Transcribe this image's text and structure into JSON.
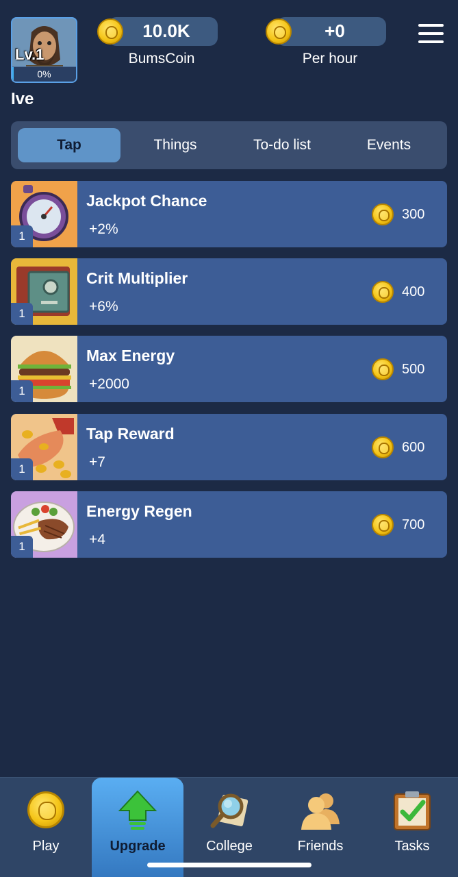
{
  "player": {
    "level": "Lv.1",
    "progress_text": "0%",
    "progress_fraction": 0.02,
    "username": "Ive"
  },
  "stats": {
    "balance": {
      "value": "10.0K",
      "label": "BumsCoin"
    },
    "per_hour": {
      "value": "+0",
      "label": "Per hour"
    }
  },
  "tabs": [
    {
      "label": "Tap",
      "active": true
    },
    {
      "label": "Things",
      "active": false
    },
    {
      "label": "To-do list",
      "active": false
    },
    {
      "label": "Events",
      "active": false
    }
  ],
  "upgrades": [
    {
      "title": "Jackpot Chance",
      "effect": "+2%",
      "level": "1",
      "cost": "300",
      "icon": "stopwatch-icon"
    },
    {
      "title": "Crit Multiplier",
      "effect": "+6%",
      "level": "1",
      "cost": "400",
      "icon": "safe-icon"
    },
    {
      "title": "Max Energy",
      "effect": "+2000",
      "level": "1",
      "cost": "500",
      "icon": "burger-icon"
    },
    {
      "title": "Tap Reward",
      "effect": "+7",
      "level": "1",
      "cost": "600",
      "icon": "coins-hand-icon"
    },
    {
      "title": "Energy Regen",
      "effect": "+4",
      "level": "1",
      "cost": "700",
      "icon": "steak-plate-icon"
    }
  ],
  "nav": [
    {
      "label": "Play",
      "icon": "coin-icon",
      "active": false
    },
    {
      "label": "Upgrade",
      "icon": "arrow-up-icon",
      "active": true
    },
    {
      "label": "College",
      "icon": "magnifier-icon",
      "active": false
    },
    {
      "label": "Friends",
      "icon": "friends-icon",
      "active": false
    },
    {
      "label": "Tasks",
      "icon": "clipboard-check-icon",
      "active": false
    }
  ],
  "colors": {
    "background": "#1c2a45",
    "card": "#3d5d96",
    "active_tab": "#5f94c8",
    "coin": "#f5c518"
  }
}
